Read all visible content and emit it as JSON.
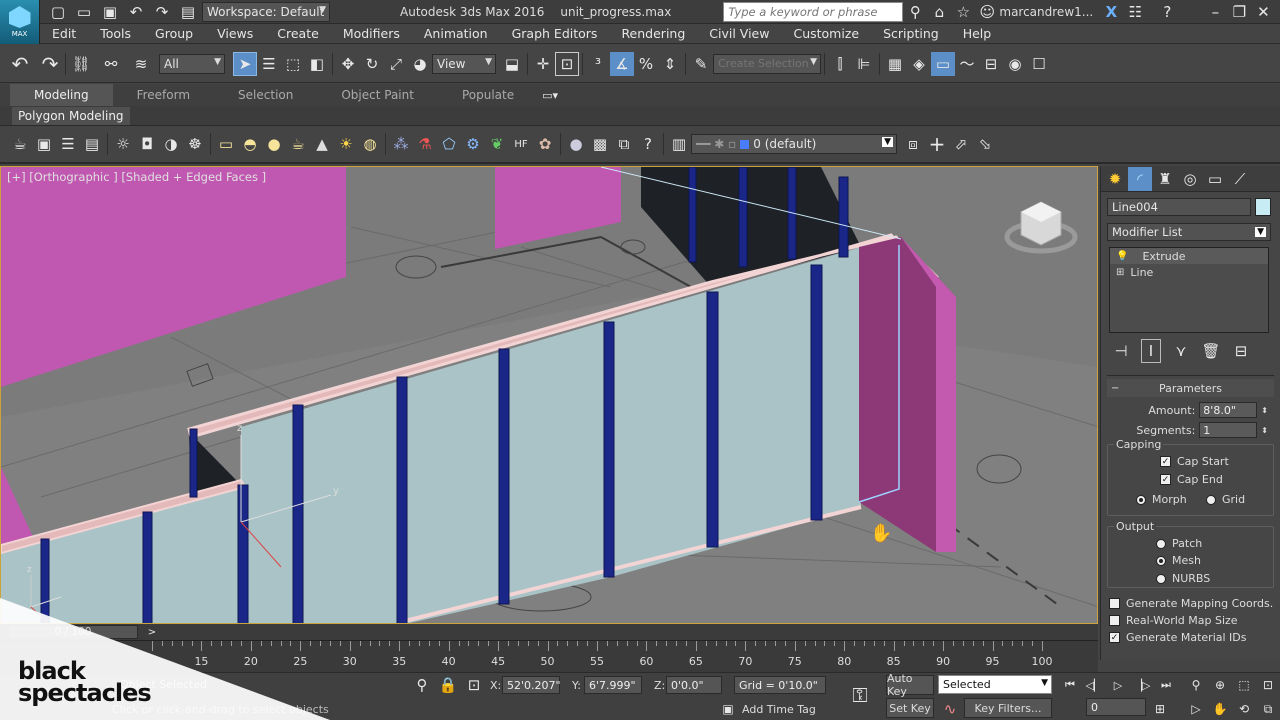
{
  "title_bar": {
    "workspace": "Workspace: Default",
    "app_title": "Autodesk 3ds Max 2016",
    "file_name": "unit_progress.max",
    "search_placeholder": "Type a keyword or phrase",
    "user": "marcandrew1...",
    "logo_label": "MAX"
  },
  "menu": [
    "Edit",
    "Tools",
    "Group",
    "Views",
    "Create",
    "Modifiers",
    "Animation",
    "Graph Editors",
    "Rendering",
    "Civil View",
    "Customize",
    "Scripting",
    "Help"
  ],
  "toolbar": {
    "filter_value": "All",
    "ref_coord_value": "View",
    "selection_set_placeholder": "Create Selection Se"
  },
  "ribbon": {
    "tabs": [
      "Modeling",
      "Freeform",
      "Selection",
      "Object Paint",
      "Populate"
    ],
    "active_tab": "Modeling",
    "sub_label": "Polygon Modeling"
  },
  "layer": {
    "value": "0 (default)"
  },
  "viewport": {
    "label": "[+] [Orthographic ] [Shaded + Edged Faces ]"
  },
  "command_panel": {
    "object_name": "Line004",
    "object_color": "#c8ecf4",
    "modifier_list": "Modifier List",
    "stack": [
      "Extrude",
      "Line"
    ],
    "rollout_title": "Parameters",
    "amount_label": "Amount:",
    "amount_value": "8'8.0\"",
    "segments_label": "Segments:",
    "segments_value": "1",
    "capping_label": "Capping",
    "cap_start": "Cap Start",
    "cap_end": "Cap End",
    "morph": "Morph",
    "grid": "Grid",
    "output_label": "Output",
    "patch": "Patch",
    "mesh": "Mesh",
    "nurbs": "NURBS",
    "gen_mapping": "Generate Mapping Coords.",
    "real_world": "Real-World Map Size",
    "gen_material": "Generate Material IDs"
  },
  "timeline": {
    "frame_display": "0 / 100",
    "ticks": [
      "15",
      "20",
      "25",
      "30",
      "35",
      "40",
      "45",
      "50",
      "55",
      "60",
      "65",
      "70",
      "75",
      "80",
      "85",
      "90",
      "95",
      "100"
    ]
  },
  "status": {
    "selected_info": "Object Selected",
    "hint": "Click or click-and-drag to select objects",
    "x_label": "X:",
    "x_value": "52'0.207\"",
    "y_label": "Y:",
    "y_value": "6'7.999\"",
    "z_label": "Z:",
    "z_value": "0'0.0\"",
    "grid_value": "Grid = 0'10.0\"",
    "auto_key": "Auto Key",
    "selected_dropdown": "Selected",
    "set_key": "Set Key",
    "key_filters": "Key Filters...",
    "add_time_tag": "Add Time Tag",
    "frame_value": "0"
  },
  "watermark": {
    "line1": "black",
    "line2": "spectacles"
  }
}
